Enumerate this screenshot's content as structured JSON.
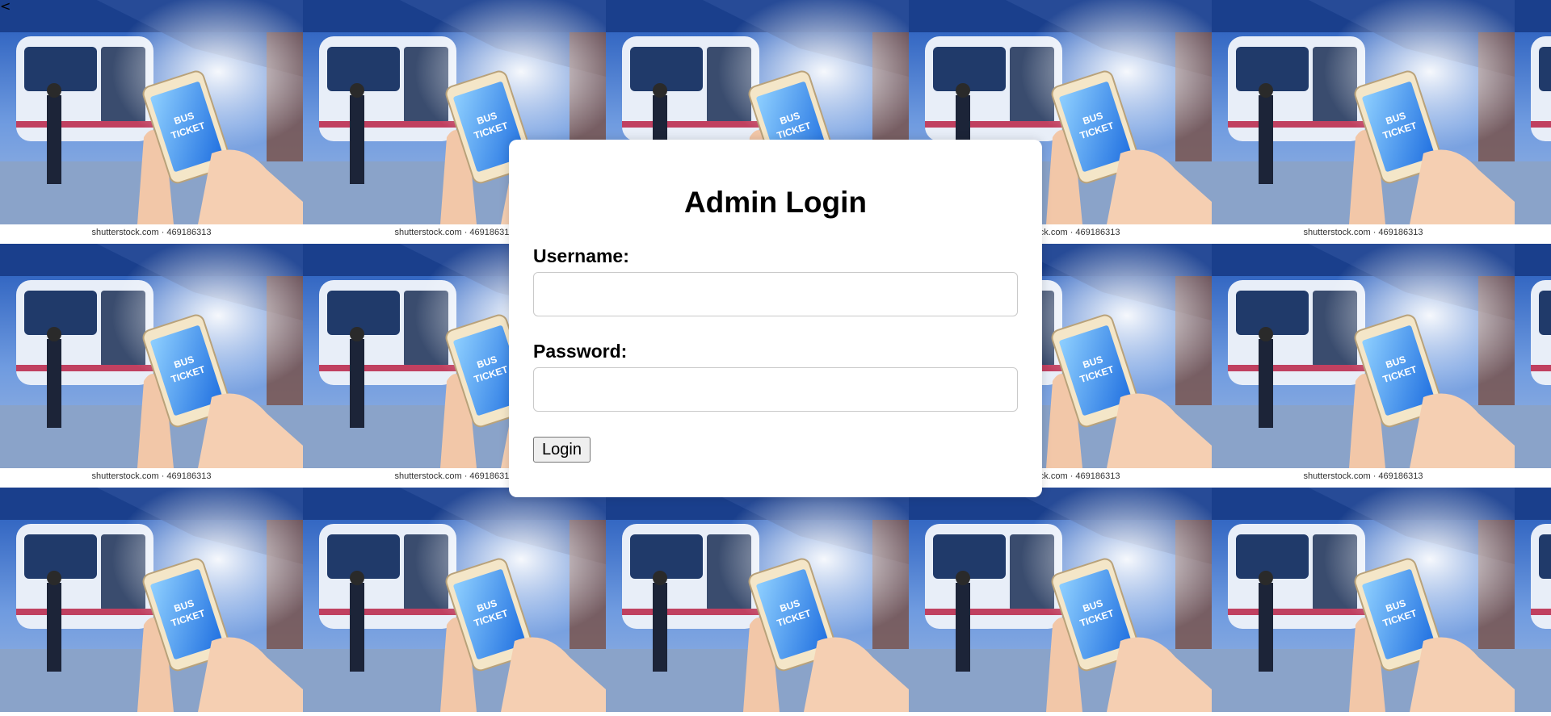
{
  "page": {
    "back_glyph": "<"
  },
  "background": {
    "watermark": "shutterstock.com · 469186313",
    "phone_label_line1": "BUS",
    "phone_label_line2": "TICKET",
    "tile_icon": "bus-ticket-photo-icon"
  },
  "login": {
    "title": "Admin Login",
    "username_label": "Username:",
    "username_value": "",
    "password_label": "Password:",
    "password_value": "",
    "submit_label": "Login"
  },
  "colors": {
    "sky_blue": "#2f6fd6",
    "card_bg": "#ffffff",
    "button_bg": "#efefef"
  }
}
